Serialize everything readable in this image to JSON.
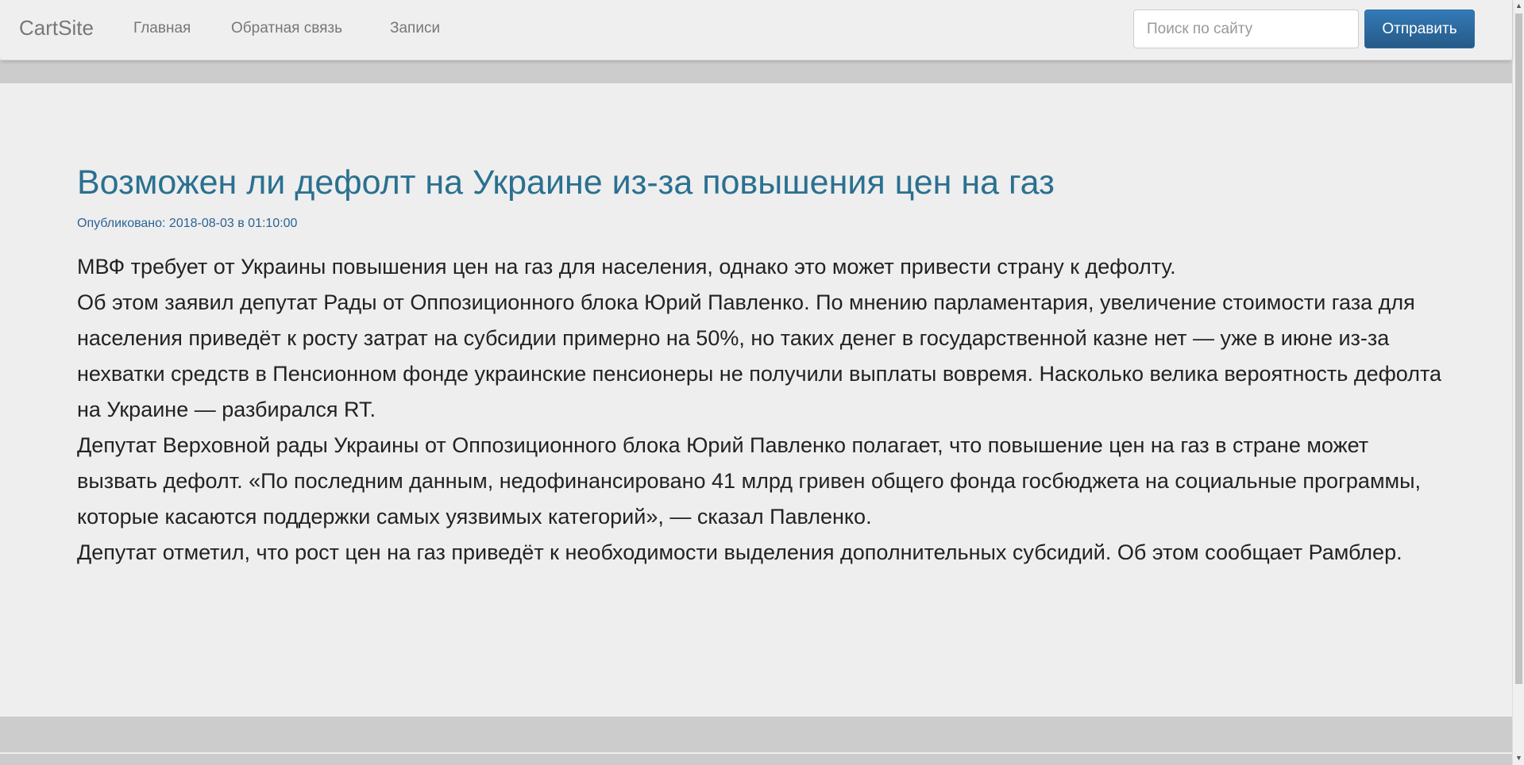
{
  "navbar": {
    "brand": "CartSite",
    "links": [
      "Главная",
      "Обратная связь",
      "Записи"
    ],
    "search_placeholder": "Поиск по сайту",
    "submit_label": "Отправить"
  },
  "article": {
    "title": "Возможен ли дефолт на Украине из-за повышения цен на газ",
    "published": "Опубликовано: 2018-08-03 в 01:10:00",
    "paragraphs": [
      "МВФ требует от Украины повышения цен на газ для населения, однако это может привести страну к дефолту.",
      "Об этом заявил депутат Рады от Оппозиционного блока Юрий Павленко. По мнению парламентария, увеличение стоимости газа для населения приведёт к росту затрат на субсидии примерно на 50%, но таких денег в государственной казне нет — уже в июне из-за нехватки средств в Пенсионном фонде украинские пенсионеры не получили выплаты вовремя. Насколько велика вероятность дефолта на Украине — разбирался RT.",
      "Депутат Верховной рады Украины от Оппозиционного блока Юрий Павленко полагает, что повышение цен на газ в стране может вызвать дефолт. «По последним данным, недофинансировано 41 млрд гривен общего фонда госбюджета на социальные программы, которые касаются поддержки самых уязвимых категорий», — сказал Павленко.",
      "Депутат отметил, что рост цен на газ приведёт к необходимости выделения дополнительных субсидий. Об этом сообщает Рамблер."
    ]
  }
}
